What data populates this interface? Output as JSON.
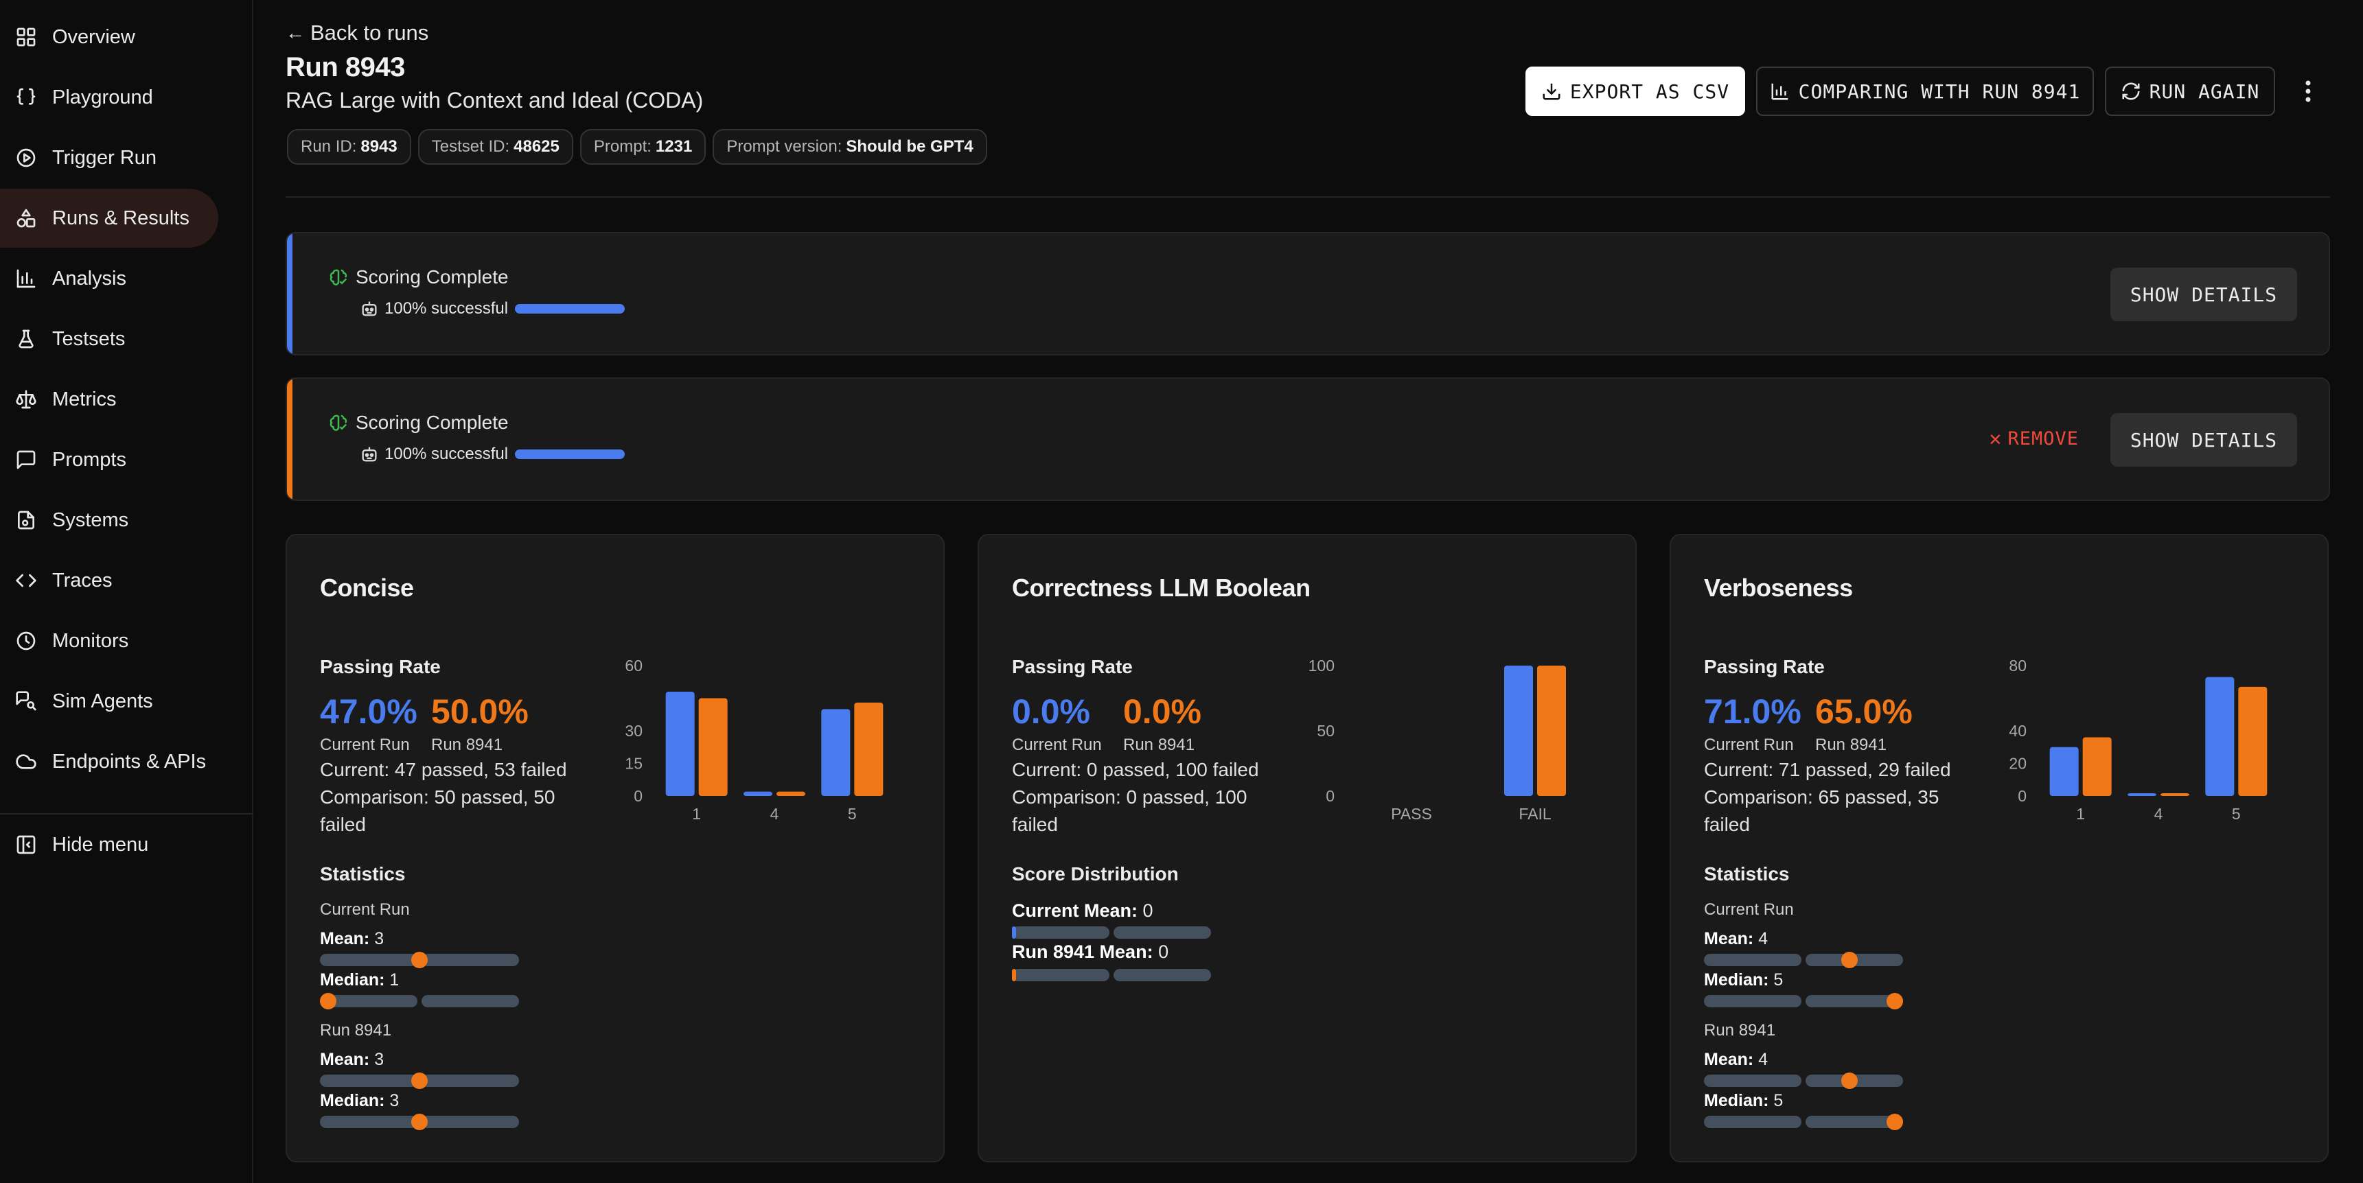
{
  "sidebar": {
    "items": [
      {
        "label": "Overview",
        "icon": "grid-icon"
      },
      {
        "label": "Playground",
        "icon": "braces-icon"
      },
      {
        "label": "Trigger Run",
        "icon": "play-circle-icon"
      },
      {
        "label": "Runs & Results",
        "icon": "shapes-icon",
        "active": true
      },
      {
        "label": "Analysis",
        "icon": "bar-chart-icon"
      },
      {
        "label": "Testsets",
        "icon": "flask-icon"
      },
      {
        "label": "Metrics",
        "icon": "scale-icon"
      },
      {
        "label": "Prompts",
        "icon": "message-square-icon"
      },
      {
        "label": "Systems",
        "icon": "file-cog-icon"
      },
      {
        "label": "Traces",
        "icon": "code-icon"
      },
      {
        "label": "Monitors",
        "icon": "clock-icon"
      },
      {
        "label": "Sim Agents",
        "icon": "messages-search-icon"
      },
      {
        "label": "Endpoints & APIs",
        "icon": "cloud-icon"
      }
    ],
    "hide_menu": "Hide menu"
  },
  "header": {
    "back_label": "Back to runs",
    "title": "Run 8943",
    "subtitle": "RAG Large with Context and Ideal (CODA)",
    "chips": [
      {
        "key": "Run ID:",
        "value": "8943"
      },
      {
        "key": "Testset ID:",
        "value": "48625"
      },
      {
        "key": "Prompt:",
        "value": "1231"
      },
      {
        "key": "Prompt version:",
        "value": "Should be GPT4"
      }
    ],
    "export_label": "EXPORT AS CSV",
    "compare_label": "COMPARING WITH RUN 8941",
    "run_again_label": "RUN AGAIN"
  },
  "banners": [
    {
      "status": "Scoring Complete",
      "progress_text": "100% successful",
      "progress": 1.0,
      "accent": "#4a7cf0",
      "show_details": "SHOW DETAILS"
    },
    {
      "status": "Scoring Complete",
      "progress_text": "100% successful",
      "progress": 1.0,
      "accent": "#f07818",
      "show_details": "SHOW DETAILS",
      "remove": "REMOVE"
    }
  ],
  "colors": {
    "current": "#4a7cf0",
    "comparison": "#f07818"
  },
  "cards": [
    {
      "title": "Concise",
      "passing_label": "Passing Rate",
      "current_rate": "47.0%",
      "comparison_rate": "50.0%",
      "current_label": "Current Run",
      "comparison_label": "Run 8941",
      "current_summary": "Current: 47 passed, 53 failed",
      "comparison_summary": "Comparison: 50 passed, 50 failed",
      "statistics_label": "Statistics",
      "current_run_label": "Current Run",
      "run_label": "Run 8941",
      "stats": [
        {
          "label": "Mean:",
          "value": "3",
          "level": 0.5
        },
        {
          "label": "Median:",
          "value": "1",
          "level": 0.0
        },
        {
          "label": "Mean:",
          "value": "3",
          "level": 0.5
        },
        {
          "label": "Median:",
          "value": "3",
          "level": 0.5
        }
      ]
    },
    {
      "title": "Correctness LLM Boolean",
      "passing_label": "Passing Rate",
      "current_rate": "0.0%",
      "comparison_rate": "0.0%",
      "current_label": "Current Run",
      "comparison_label": "Run 8941",
      "current_summary": "Current: 0 passed, 100 failed",
      "comparison_summary": "Comparison: 0 passed, 100 failed",
      "distribution_label": "Score Distribution",
      "current_mean_label": "Current Mean:",
      "current_mean_value": "0",
      "run_mean_label": "Run 8941 Mean:",
      "run_mean_value": "0"
    },
    {
      "title": "Verboseness",
      "passing_label": "Passing Rate",
      "current_rate": "71.0%",
      "comparison_rate": "65.0%",
      "current_label": "Current Run",
      "comparison_label": "Run 8941",
      "current_summary": "Current: 71 passed, 29 failed",
      "comparison_summary": "Comparison: 65 passed, 35 failed",
      "statistics_label": "Statistics",
      "current_run_label": "Current Run",
      "run_label": "Run 8941",
      "stats": [
        {
          "label": "Mean:",
          "value": "4",
          "level": 0.75
        },
        {
          "label": "Median:",
          "value": "5",
          "level": 1.0
        },
        {
          "label": "Mean:",
          "value": "4",
          "level": 0.75
        },
        {
          "label": "Median:",
          "value": "5",
          "level": 1.0
        }
      ]
    }
  ],
  "chart_data": [
    {
      "type": "bar",
      "categories": [
        "1",
        "4",
        "5"
      ],
      "series": [
        {
          "values": [
            48,
            2,
            40
          ]
        },
        {
          "values": [
            45,
            2,
            43
          ]
        }
      ],
      "yticks": [
        0,
        15,
        30,
        60
      ],
      "ylim": [
        0,
        60
      ],
      "legend": "none"
    },
    {
      "type": "bar",
      "categories": [
        "PASS",
        "FAIL"
      ],
      "series": [
        {
          "values": [
            0,
            100
          ]
        },
        {
          "values": [
            0,
            100
          ]
        }
      ],
      "yticks": [
        0,
        50,
        100
      ],
      "ylim": [
        0,
        100
      ],
      "legend": "none"
    },
    {
      "type": "bar",
      "categories": [
        "1",
        "4",
        "5"
      ],
      "series": [
        {
          "values": [
            30,
            1,
            73
          ]
        },
        {
          "values": [
            36,
            1,
            67
          ]
        }
      ],
      "yticks": [
        0,
        20,
        40,
        80
      ],
      "ylim": [
        0,
        80
      ],
      "legend": "none"
    }
  ]
}
